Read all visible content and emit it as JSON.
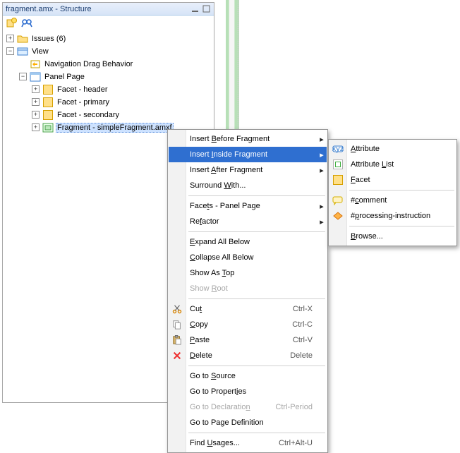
{
  "panel": {
    "title": "fragment.amx - Structure"
  },
  "tree": {
    "issues": {
      "label": "Issues (6)"
    },
    "view": {
      "label": "View"
    },
    "nav": {
      "label": "Navigation Drag Behavior"
    },
    "panelPage": {
      "label": "Panel Page"
    },
    "facetHeader": {
      "label": "Facet - header"
    },
    "facetPrimary": {
      "label": "Facet - primary"
    },
    "facetSecondary": {
      "label": "Facet - secondary"
    },
    "fragment": {
      "label": "Fragment - simpleFragment.amxf"
    }
  },
  "menu": {
    "insertBefore": {
      "pre": "Insert ",
      "u": "B",
      "post": "efore Fragment"
    },
    "insertInside": {
      "pre": "Insert ",
      "u": "I",
      "post": "nside Fragment"
    },
    "insertAfter": {
      "pre": "Insert ",
      "u": "A",
      "post": "fter Fragment"
    },
    "surroundWith": {
      "pre": "Surround ",
      "u": "W",
      "post": "ith..."
    },
    "facets": {
      "pre": "Face",
      "u": "t",
      "post": "s - Panel Page"
    },
    "refactor": {
      "pre": "Re",
      "u": "f",
      "post": "actor"
    },
    "expandAll": {
      "pre": "",
      "u": "E",
      "post": "xpand All Below"
    },
    "collapseAll": {
      "pre": "",
      "u": "C",
      "post": "ollapse All Below"
    },
    "showAsTop": {
      "pre": "Show As ",
      "u": "T",
      "post": "op"
    },
    "showRoot": {
      "pre": "Show ",
      "u": "R",
      "post": "oot"
    },
    "cut": {
      "pre": "Cu",
      "u": "t",
      "post": "",
      "accel": "Ctrl-X"
    },
    "copy": {
      "pre": "",
      "u": "C",
      "post": "opy",
      "accel": "Ctrl-C"
    },
    "paste": {
      "pre": "",
      "u": "P",
      "post": "aste",
      "accel": "Ctrl-V"
    },
    "delete": {
      "pre": "",
      "u": "D",
      "post": "elete",
      "accel": "Delete"
    },
    "goSource": {
      "pre": "Go to ",
      "u": "S",
      "post": "ource"
    },
    "goProperties": {
      "pre": "Go to Propert",
      "u": "i",
      "post": "es"
    },
    "goDecl": {
      "pre": "Go to Declaratio",
      "u": "n",
      "post": "",
      "accel": "Ctrl-Period"
    },
    "goPageDef": {
      "pre": "Go to Pa",
      "u": "g",
      "post": "e Definition"
    },
    "findUsages": {
      "pre": "Find ",
      "u": "U",
      "post": "sages...",
      "accel": "Ctrl+Alt-U"
    }
  },
  "submenu": {
    "attribute": {
      "pre": "",
      "u": "A",
      "post": "ttribute"
    },
    "attrList": {
      "pre": "Attribute ",
      "u": "L",
      "post": "ist"
    },
    "facet": {
      "pre": "",
      "u": "F",
      "post": "acet"
    },
    "comment": {
      "pre": "#",
      "u": "c",
      "post": "omment"
    },
    "procInstr": {
      "pre": "#",
      "u": "p",
      "post": "rocessing-instruction"
    },
    "browse": {
      "pre": "",
      "u": "B",
      "post": "rowse..."
    }
  }
}
